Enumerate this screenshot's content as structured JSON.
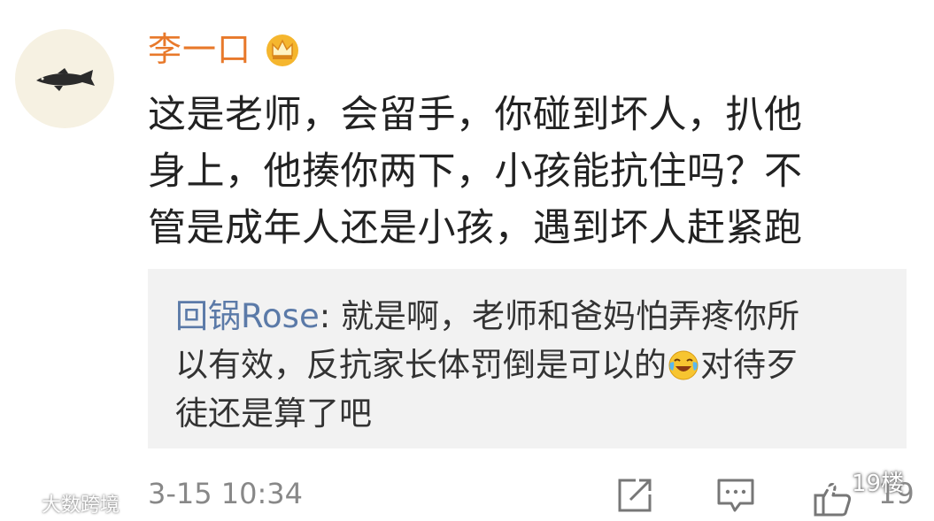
{
  "comment": {
    "username": "李一口",
    "text_lines": [
      "这是老师，会留手，你碰到坏人，扒他",
      "身上，他揍你两下，小孩能抗住吗？不",
      "管是成年人还是小孩，遇到坏人赶紧跑"
    ],
    "timestamp": "3-15 10:34"
  },
  "reply": {
    "username": "回锅Rose",
    "separator": ": ",
    "line1": "就是啊，老师和爸妈怕弄疼你所",
    "line2_before_emoji": "以有效，反抗家长体罚倒是可以的",
    "line2_after_emoji": "对待歹",
    "line3": "徒还是算了吧"
  },
  "actions": {
    "like_count": "19",
    "icons": [
      "share-icon",
      "comment-icon",
      "like-icon"
    ]
  },
  "watermarks": {
    "right": "19楼",
    "left": "大数跨境"
  },
  "colors": {
    "username": "#e8792b",
    "reply_user": "#5b7aa8",
    "reply_background": "#f2f2f2",
    "meta_text": "#888888"
  }
}
